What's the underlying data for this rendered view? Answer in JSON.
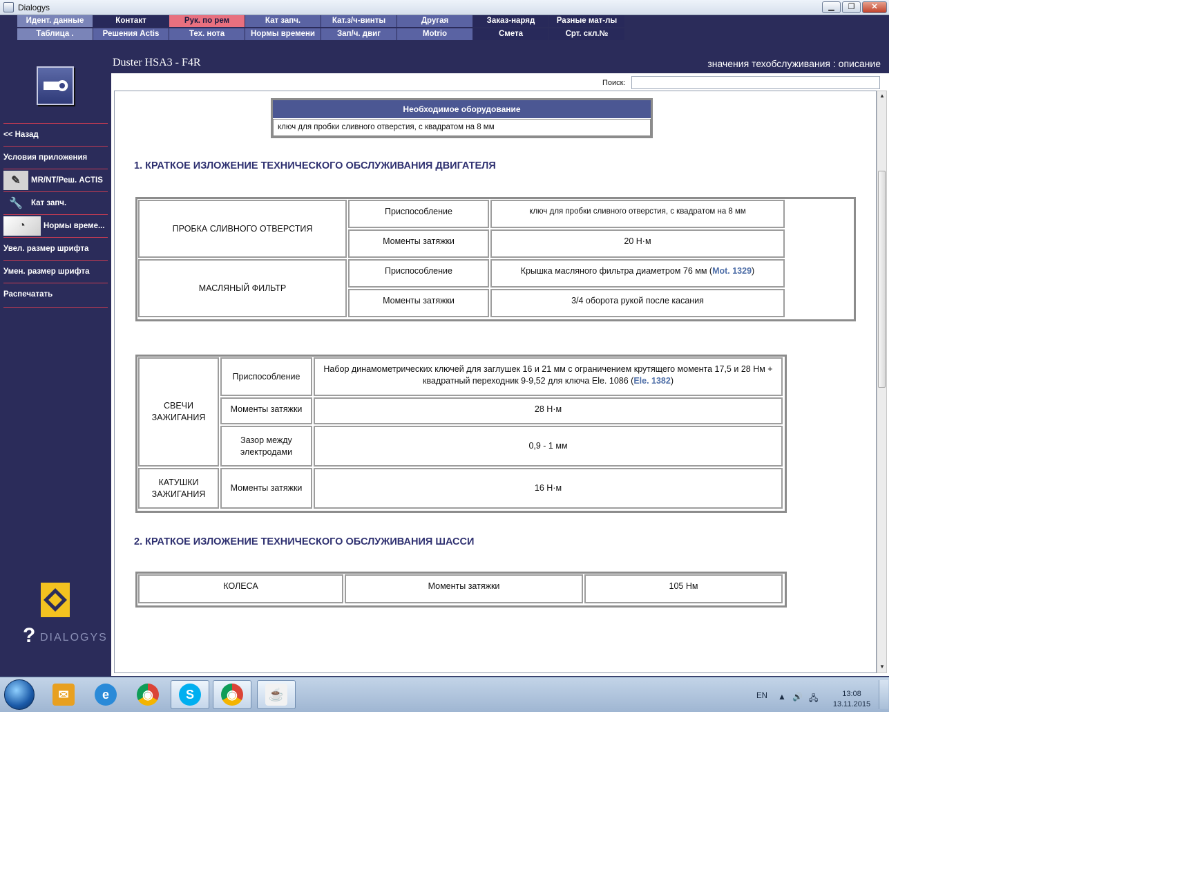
{
  "window": {
    "title": "Dialogys",
    "controls": {
      "minimize": "▁",
      "maximize": "❐",
      "close": "✕"
    }
  },
  "menu": {
    "row1": [
      {
        "label": "Идент. данные",
        "bg": "#7a84b8",
        "color": "#ffffff"
      },
      {
        "label": "Контакт",
        "bg": "#28295a",
        "color": "#ffffff"
      },
      {
        "label": "Рук. по рем",
        "bg": "#e8707f",
        "color": "#1a1a40"
      },
      {
        "label": "Кат запч.",
        "bg": "#5a63a3",
        "color": "#ffffff"
      },
      {
        "label": "Кат.з/ч-винты",
        "bg": "#5a63a3",
        "color": "#ffffff"
      },
      {
        "label": "Другая",
        "bg": "#5a63a3",
        "color": "#ffffff"
      },
      {
        "label": "Заказ-наряд",
        "bg": "#28295a",
        "color": "#ffffff"
      },
      {
        "label": "Разные мат-лы",
        "bg": "#28295a",
        "color": "#ffffff"
      }
    ],
    "row2": [
      {
        "label": "Таблица .",
        "bg": "#7a84b8",
        "color": "#ffffff"
      },
      {
        "label": "Решения Actis",
        "bg": "#5a63a3",
        "color": "#ffffff"
      },
      {
        "label": "Тех. нота",
        "bg": "#5a63a3",
        "color": "#ffffff"
      },
      {
        "label": "Нормы времени",
        "bg": "#5a63a3",
        "color": "#ffffff"
      },
      {
        "label": "Зап/ч. двиг",
        "bg": "#5a63a3",
        "color": "#ffffff"
      },
      {
        "label": "Motrio",
        "bg": "#5a63a3",
        "color": "#ffffff"
      },
      {
        "label": "Смета",
        "bg": "#28295a",
        "color": "#ffffff"
      },
      {
        "label": "Срт. скл.№",
        "bg": "#28295a",
        "color": "#ffffff"
      }
    ]
  },
  "sidebar": {
    "items": [
      {
        "label": "<< Назад",
        "icon": ""
      },
      {
        "label": "Условия приложения",
        "icon": ""
      },
      {
        "label": "MR/NT/Реш. ACTIS",
        "icon": "manual-icon"
      },
      {
        "label": "Кат запч.",
        "icon": "wrench-icon"
      },
      {
        "label": "Нормы време...",
        "icon": "clock-dial-icon"
      },
      {
        "label": "Увел. размер шрифта",
        "icon": ""
      },
      {
        "label": "Умен. размер шрифта",
        "icon": ""
      },
      {
        "label": "Распечатать",
        "icon": ""
      }
    ],
    "logo_text": "DIALOGYS",
    "logo_q": "?"
  },
  "header": {
    "vehicle": "Duster HSA3 - F4R",
    "section": "значения техобслуживания : описание"
  },
  "search": {
    "label": "Поиск:",
    "value": ""
  },
  "document": {
    "equipment": {
      "header": "Необходимое оборудование",
      "value": "ключ для пробки сливного отверстия, с квадратом на 8 мм"
    },
    "section1_title": "1. КРАТКОЕ ИЗЛОЖЕНИЕ ТЕХНИЧЕСКОГО ОБСЛУЖИВАНИЯ ДВИГАТЕЛЯ",
    "table1": {
      "drain_plug": {
        "name": "ПРОБКА СЛИВНОГО ОТВЕРСТИЯ",
        "tool_label": "Приспособление",
        "tool_value": "ключ для пробки сливного отверстия, с квадратом на 8 мм",
        "torque_label": "Моменты затяжки",
        "torque_value": "20 Н·м"
      },
      "oil_filter": {
        "name": "МАСЛЯНЫЙ ФИЛЬТР",
        "tool_label": "Приспособление",
        "tool_value_pre": "Крышка масляного фильтра диаметром 76 мм (",
        "tool_ref": "Mot. 1329",
        "tool_value_post": ")",
        "torque_label": "Моменты затяжки",
        "torque_value": "3/4 оборота рукой после касания"
      }
    },
    "table2": {
      "spark_plugs": {
        "name": "СВЕЧИ ЗАЖИГАНИЯ",
        "tool_label": "Приспособление",
        "tool_value_pre": "Набор динамометрических ключей для заглушек 16 и 21 мм с ограничением крутящего момента 17,5 и 28 Нм + квадратный переходник 9-9,52 для ключа Ele. 1086 (",
        "tool_ref": "Ele. 1382",
        "tool_value_post": ")",
        "torque_label": "Моменты затяжки",
        "torque_value": "28 Н·м",
        "gap_label": "Зазор между электродами",
        "gap_value": "0,9 - 1 мм"
      },
      "coils": {
        "name": "КАТУШКИ ЗАЖИГАНИЯ",
        "torque_label": "Моменты затяжки",
        "torque_value": "16 Н·м"
      }
    },
    "section2_title": "2. КРАТКОЕ ИЗЛОЖЕНИЕ ТЕХНИЧЕСКОГО ОБСЛУЖИВАНИЯ ШАССИ",
    "table3": {
      "name": "КОЛЕСА",
      "torque_label": "Моменты затяжки",
      "torque_value": "105 Нм"
    }
  },
  "taskbar": {
    "language": "EN",
    "time": "13:08",
    "date": "13.11.2015",
    "apps": [
      {
        "icon": "outlook-icon",
        "glyph": "✉",
        "color": "#e8a020"
      },
      {
        "icon": "internet-explorer-icon",
        "glyph": "e",
        "color": "#2a8ad8"
      },
      {
        "icon": "chrome-icon",
        "glyph": "◉",
        "color": "#db4437"
      },
      {
        "icon": "skype-icon",
        "glyph": "S",
        "color": "#00aff0"
      },
      {
        "icon": "chrome-icon",
        "glyph": "◉",
        "color": "#db4437"
      },
      {
        "icon": "java-icon",
        "glyph": "☕",
        "color": "#e76f00"
      }
    ]
  }
}
